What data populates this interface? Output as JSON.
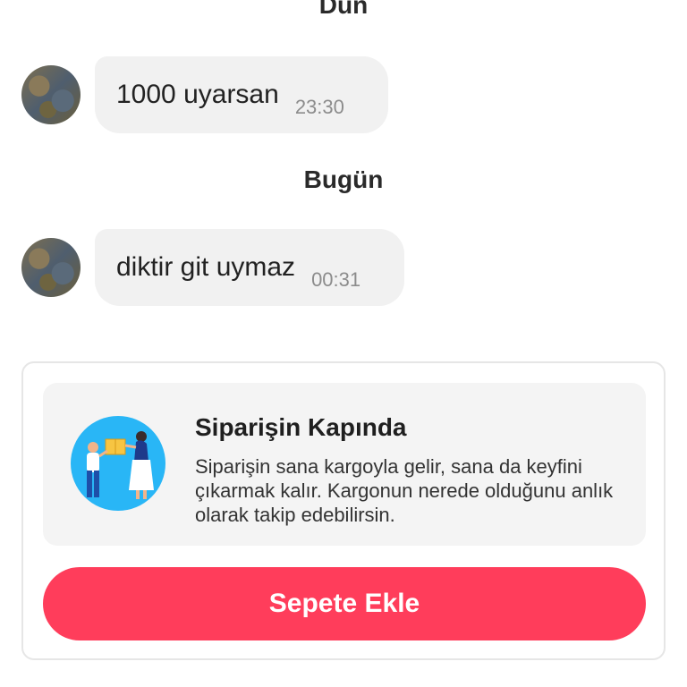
{
  "chat": {
    "day_separators": [
      "Dün",
      "Bugün"
    ],
    "messages": [
      {
        "text": "1000 uyarsan",
        "time": "23:30"
      },
      {
        "text": "diktir git uymaz",
        "time": "00:31"
      }
    ]
  },
  "delivery_card": {
    "title": "Siparişin Kapında",
    "description": "Siparişin sana kargoyla gelir, sana da keyfini çıkarmak kalır. Kargonun nerede olduğunu anlık olarak takip edebilirsin.",
    "illustration_icon": "delivery-illustration-icon"
  },
  "cta_button": {
    "label": "Sepete Ekle"
  },
  "colors": {
    "accent": "#ff3d5b",
    "bubble": "#f1f1f1",
    "info_bg": "#f4f4f4"
  }
}
